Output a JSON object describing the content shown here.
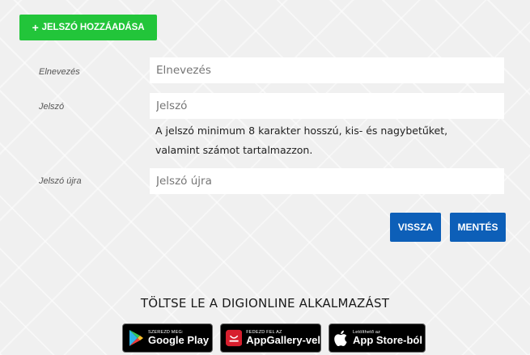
{
  "form": {
    "add_button_label": "JELSZÓ HOZZÁADÁSA",
    "name_label": "Elnevezés",
    "name_placeholder": "Elnevezés",
    "password_label": "Jelszó",
    "password_placeholder": "Jelszó",
    "password_hint_line1": "A jelszó minimum 8 karakter hosszú, kis- és nagybetűket,",
    "password_hint_line2": "valamint számot tartalmazzon.",
    "password_again_label": "Jelszó újra",
    "password_again_placeholder": "Jelszó újra",
    "back_label": "VISSZA",
    "save_label": "MENTÉS"
  },
  "promo": {
    "title": "TÖLTSE LE A DIGIONLINE ALKALMAZÁST",
    "google_small": "SZEREZD MEG:",
    "google_big": "Google Play",
    "huawei_small": "FEDEZD FEL AZ",
    "huawei_big": "AppGallery-vel",
    "apple_small": "Letölthető az",
    "apple_big": "App Store-ból"
  },
  "colors": {
    "add_button": "#22c53a",
    "primary_button": "#0d5fb8",
    "huawei_red": "#d71f2e"
  }
}
